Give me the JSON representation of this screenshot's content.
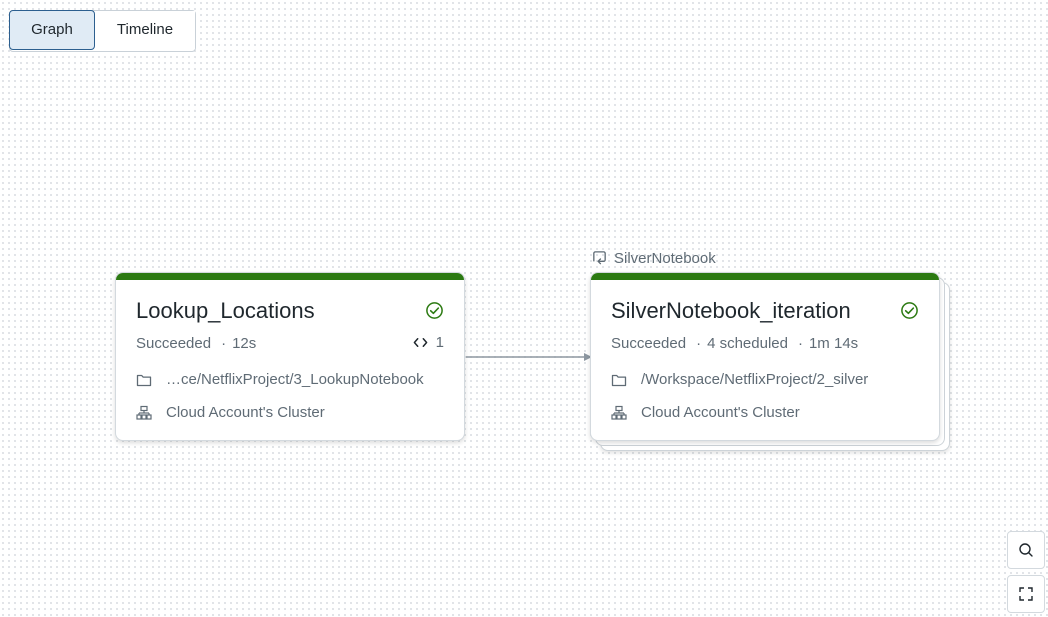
{
  "view_toggle": {
    "graph_label": "Graph",
    "timeline_label": "Timeline"
  },
  "group": {
    "label": "SilverNotebook"
  },
  "tasks": [
    {
      "name": "Lookup_Locations",
      "status": "Succeeded",
      "duration": "12s",
      "code_count": "1",
      "path": "…ce/NetflixProject/3_LookupNotebook",
      "cluster": "Cloud Account's Cluster"
    },
    {
      "name": "SilverNotebook_iteration",
      "status": "Succeeded",
      "scheduled": "4 scheduled",
      "duration": "1m 14s",
      "path": "/Workspace/NetflixProject/2_silver",
      "cluster": "Cloud Account's Cluster"
    }
  ],
  "colors": {
    "success": "#2c7a12",
    "accent_border": "#2c5f8f",
    "selected_bg": "#e0ebf5"
  },
  "icons": {
    "success": "check-circle-icon",
    "code": "code-icon",
    "folder": "folder-icon",
    "cluster": "cluster-icon",
    "loop": "loop-icon",
    "zoom": "search-icon",
    "fit": "fit-view-icon"
  }
}
